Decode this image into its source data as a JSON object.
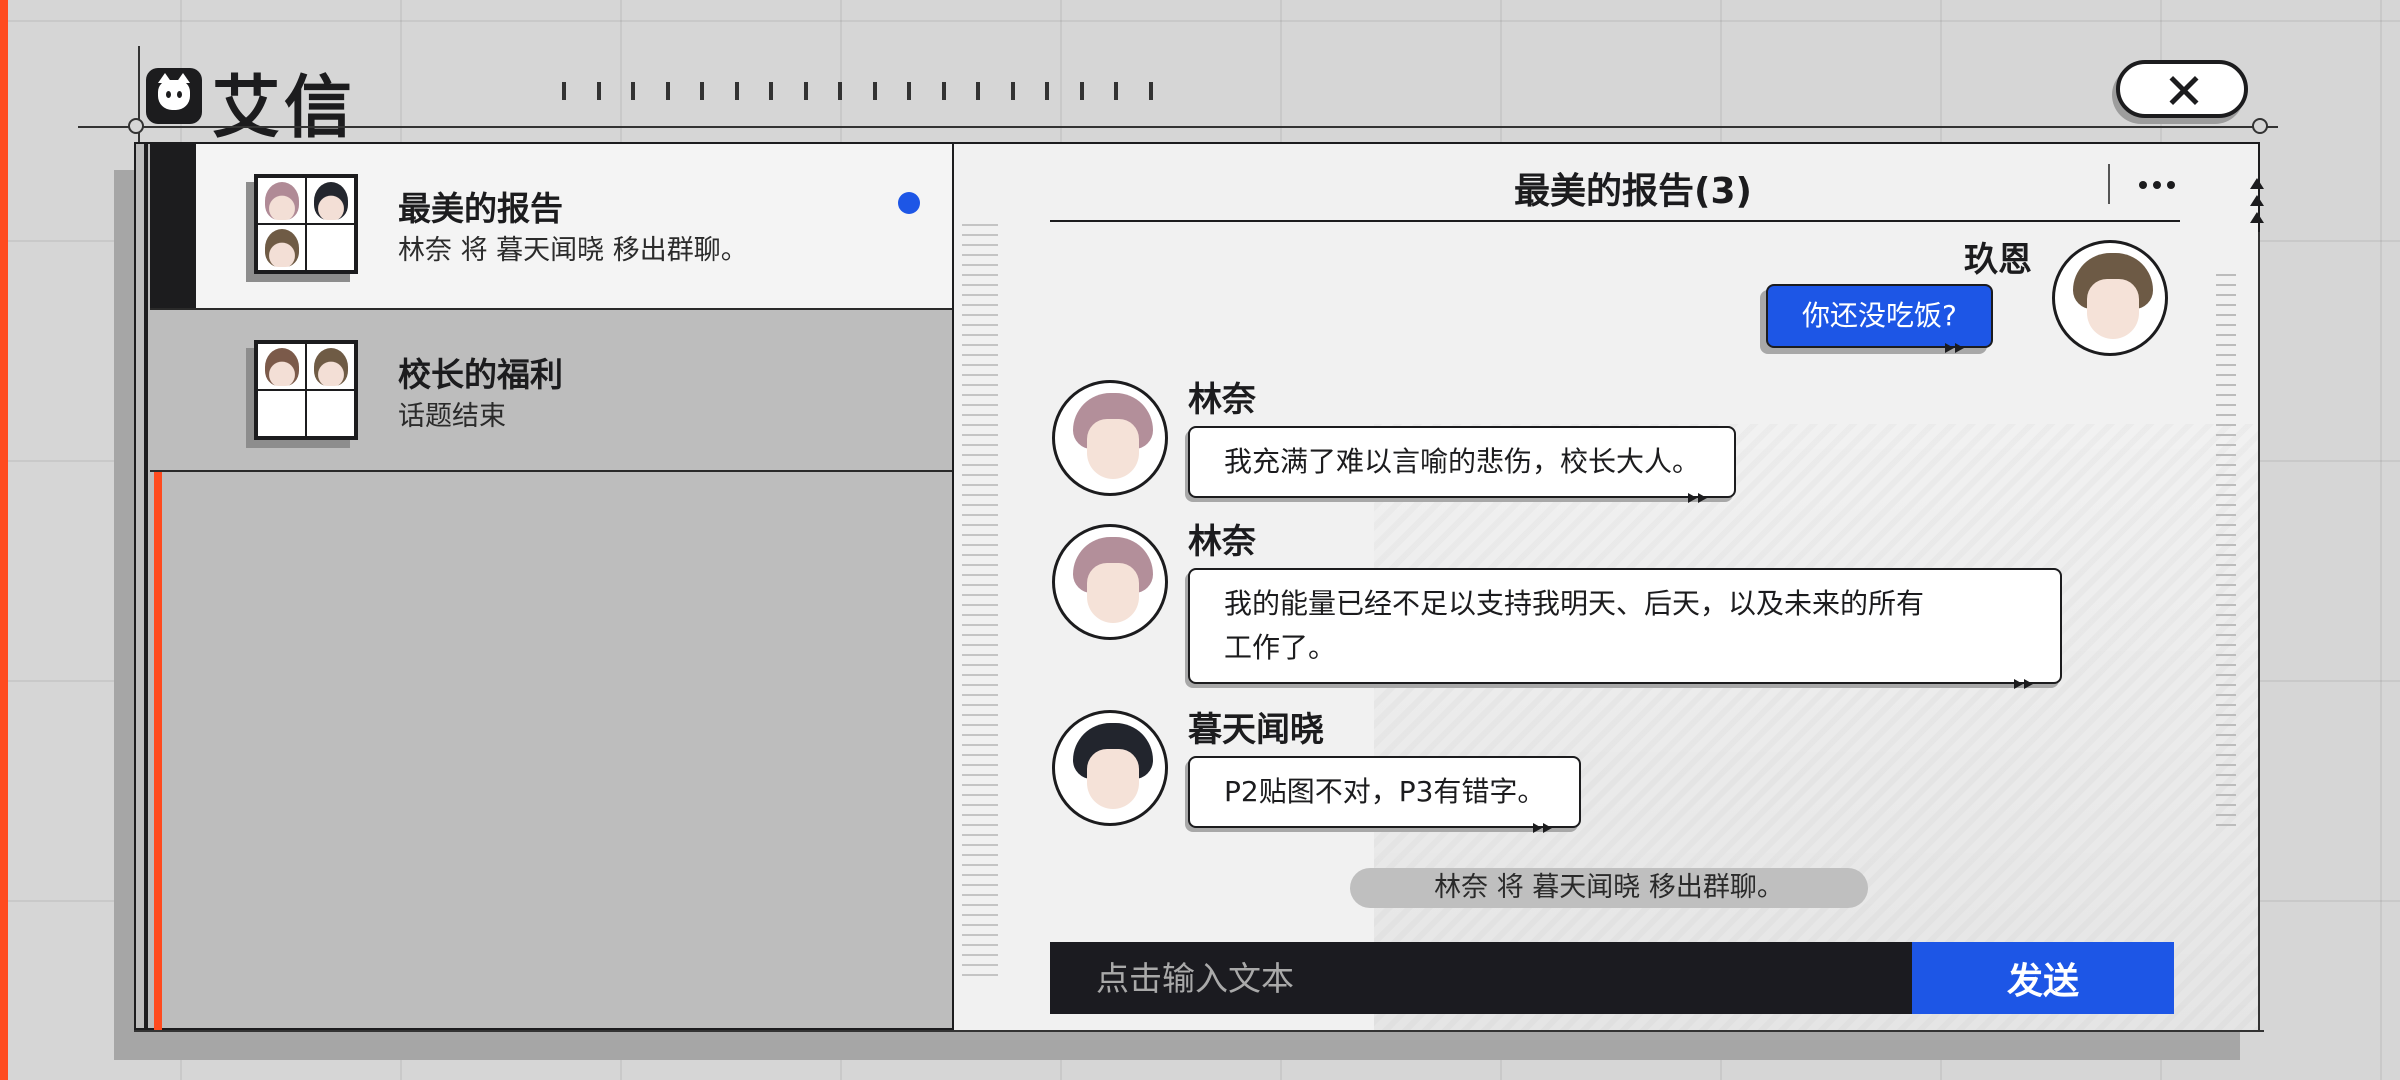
{
  "app": {
    "title": "艾信",
    "logo_icon": "cat-icon"
  },
  "header": {
    "close_icon": "close-icon"
  },
  "conversations": [
    {
      "name": "最美的报告",
      "preview": "林奈 将 暮天闻晓 移出群聊。",
      "active": true,
      "unread": true
    },
    {
      "name": "校长的福利",
      "preview": "话题结束",
      "active": false,
      "unread": false
    }
  ],
  "chat": {
    "title": "最美的报告(3)",
    "more_icon": "more-icon",
    "messages": [
      {
        "sender": "玖恩",
        "text": "你还没吃饭?",
        "mine": true
      },
      {
        "sender": "林奈",
        "text": "我充满了难以言喻的悲伤，校长大人。",
        "mine": false
      },
      {
        "sender": "林奈",
        "text_line1": "我的能量已经不足以支持我明天、后天，以及未来的所有",
        "text_line2": "工作了。",
        "mine": false
      },
      {
        "sender": "暮天闻晓",
        "text": "P2贴图不对，P3有错字。",
        "mine": false
      }
    ],
    "system_notice": "林奈 将 暮天闻晓 移出群聊。"
  },
  "composer": {
    "placeholder": "点击输入文本",
    "send_label": "发送"
  },
  "colors": {
    "accent_orange": "#ff4b1f",
    "accent_blue": "#1d56e6",
    "dark": "#1c1c1e",
    "background": "#d6d6d6"
  }
}
